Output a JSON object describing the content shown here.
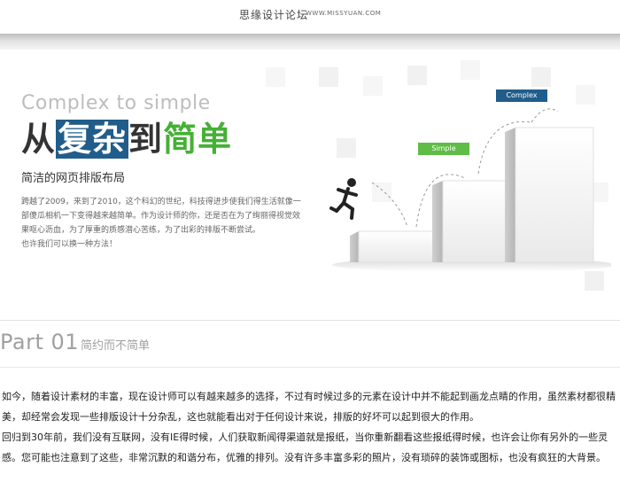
{
  "header": {
    "site_title": "思缘设计论坛",
    "site_url": "WWW.MISSYUAN.COM"
  },
  "banner": {
    "tagline_en": "Complex to simple",
    "headline": {
      "part1": "从",
      "part2": "复杂",
      "part3": "到",
      "part4": "简单"
    },
    "subheading": "简洁的网页排版布局",
    "paragraphs": [
      "跨越了2009，来到了2010，这个科幻的世纪，科技得进步使我们得生活就像一",
      "部傻瓜相机一下变得越来越简单。作为设计师的你，还是否在为了绚丽得视觉效",
      "果呕心沥血，为了厚重的质感潜心苦练，为了出彩的排版不断尝试。",
      "也许我们可以换一种方法！"
    ],
    "label_complex": "Complex",
    "label_simple": "Simple",
    "colors": {
      "complex": "#215d8a",
      "simple": "#5fbc46",
      "headline_green": "#45b035"
    },
    "icons": [
      "running-man-icon"
    ]
  },
  "section": {
    "part": "Part 01",
    "subtitle": "简约而不简单"
  },
  "article": {
    "paragraphs": [
      "如今，随着设计素材的丰富，现在设计师可以有越来越多的选择，不过有时候过多的元素在设计中并不能起到画龙点睛的作用，虽然素材都很精美，却经常会发现一些排版设计十分杂乱，这也就能看出对于任何设计来说，排版的好坏可以起到很大的作用。",
      "回归到30年前，我们没有互联网，没有IE得时候，人们获取新闻得渠道就是报纸，当你重新翻看这些报纸得时候，也许会让你有另外的一些灵感。您可能也注意到了这些，非常沉默的和谐分布，优雅的排列。没有许多丰富多彩的照片，没有琐碎的装饰或图标，也没有疯狂的大背景。"
    ]
  }
}
